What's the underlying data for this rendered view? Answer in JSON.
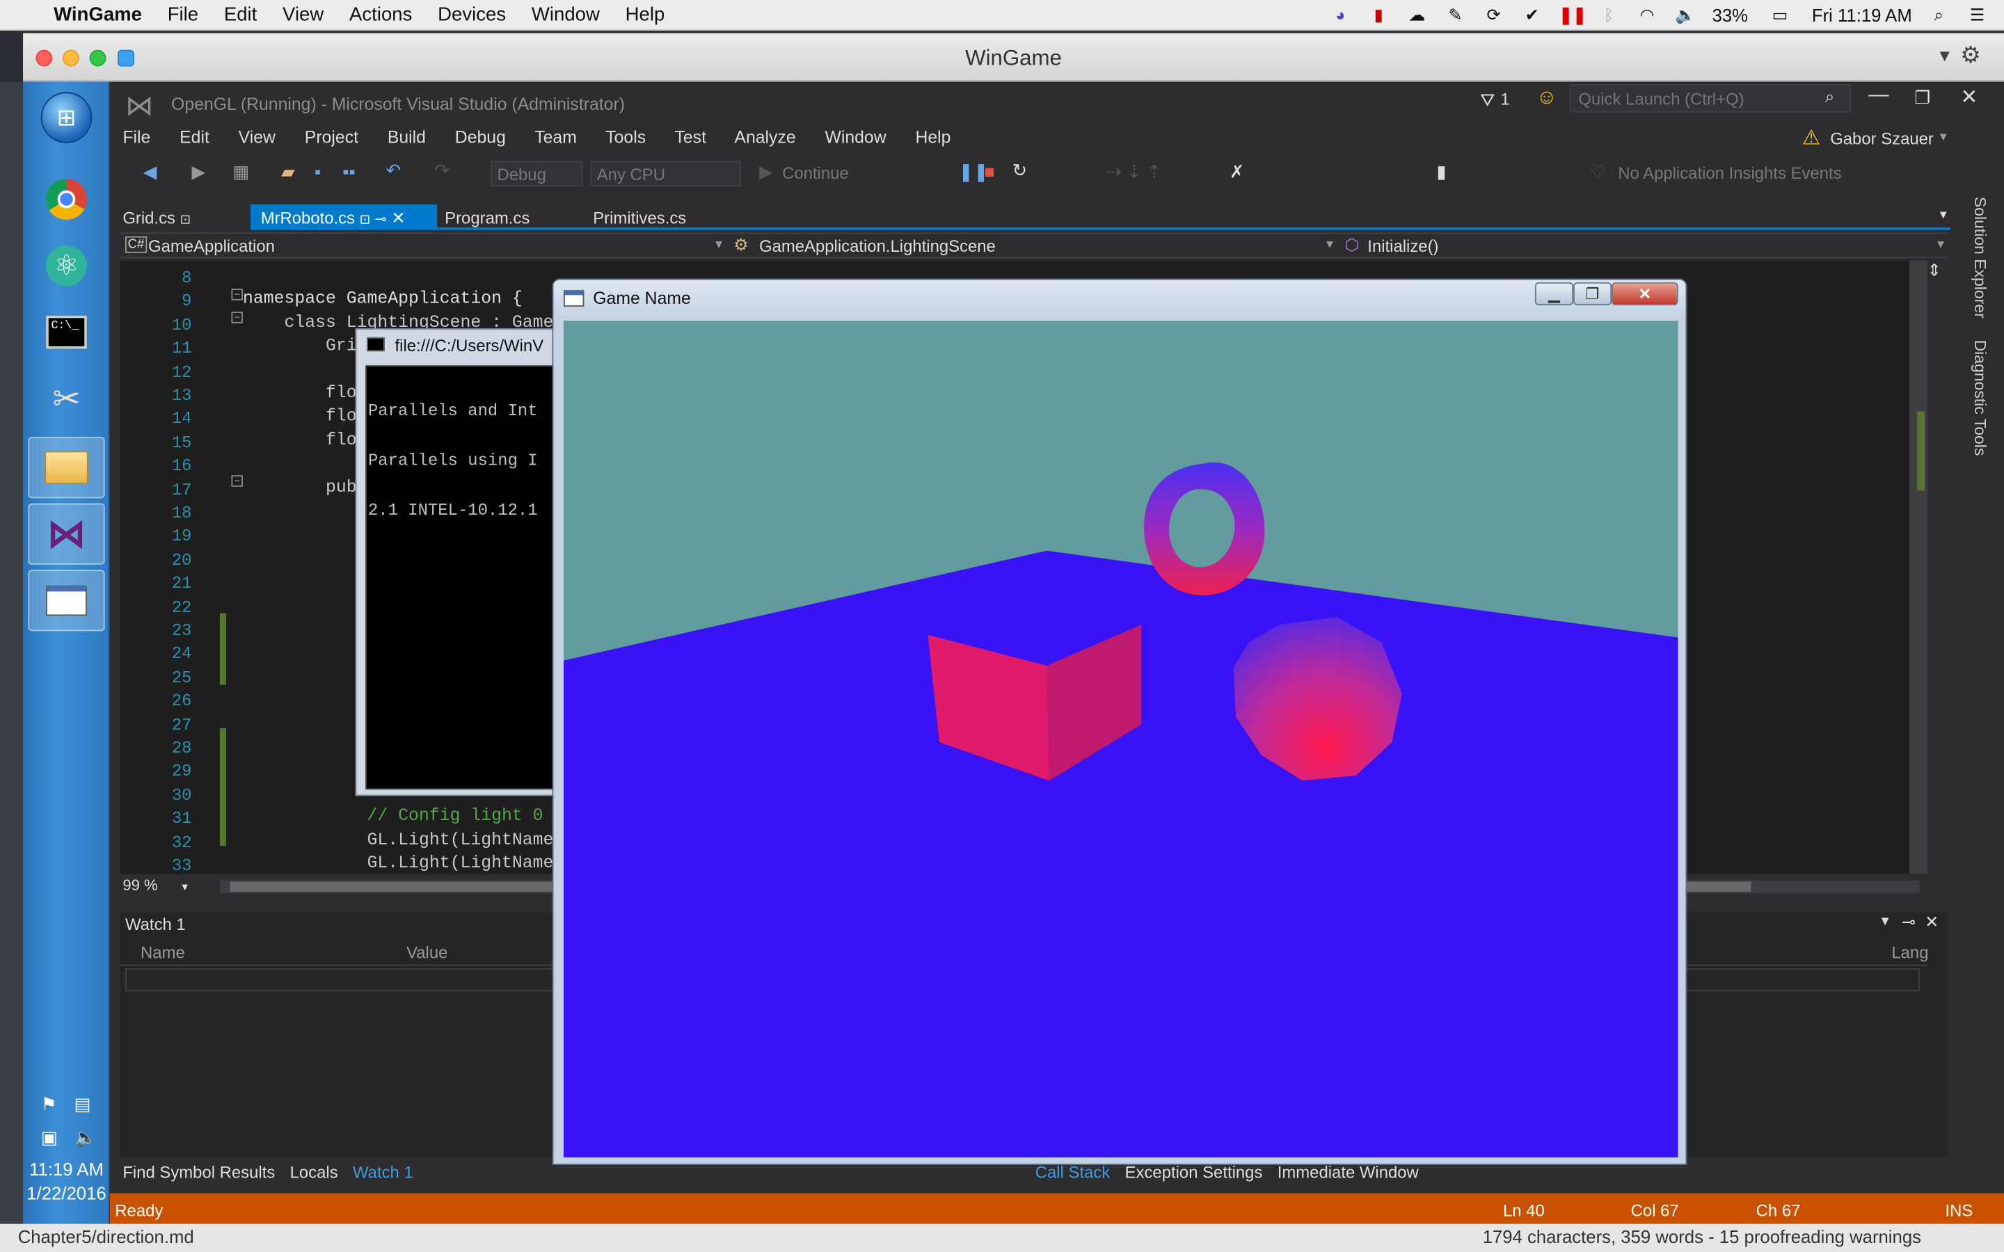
{
  "mac_menubar": {
    "app": "WinGame",
    "items": [
      "File",
      "Edit",
      "View",
      "Actions",
      "Devices",
      "Window",
      "Help"
    ],
    "battery": "33%",
    "clock": "Fri 11:19 AM"
  },
  "window": {
    "title": "WinGame"
  },
  "taskbar": {
    "time": "11:19 AM",
    "date": "1/22/2016"
  },
  "vs": {
    "title": "OpenGL (Running) - Microsoft Visual Studio (Administrator)",
    "notifications": "1",
    "quick_launch_placeholder": "Quick Launch (Ctrl+Q)",
    "user": "Gabor Szauer",
    "menu": [
      "File",
      "Edit",
      "View",
      "Project",
      "Build",
      "Debug",
      "Team",
      "Tools",
      "Test",
      "Analyze",
      "Window",
      "Help"
    ],
    "toolbar": {
      "config": "Debug",
      "platform": "Any CPU",
      "continue": "Continue",
      "insights": "No Application Insights Events"
    },
    "tabs": [
      {
        "label": "Grid.cs"
      },
      {
        "label": "MrRoboto.cs"
      },
      {
        "label": "Program.cs"
      },
      {
        "label": "Primitives.cs"
      }
    ],
    "nav": {
      "project": "GameApplication",
      "type": "GameApplication.LightingScene",
      "member": "Initialize()"
    },
    "side_panels": [
      "Solution Explorer",
      "Diagnostic Tools"
    ],
    "code_lines": [
      {
        "n": "8",
        "text": ""
      },
      {
        "n": "9",
        "text": "namespace GameApplication {"
      },
      {
        "n": "10",
        "text": "    class LightingScene : Game{"
      },
      {
        "n": "11",
        "text": "        Gri"
      },
      {
        "n": "12",
        "text": ""
      },
      {
        "n": "13",
        "text": "        flo"
      },
      {
        "n": "14",
        "text": "        flo"
      },
      {
        "n": "15",
        "text": "        flo"
      },
      {
        "n": "16",
        "text": ""
      },
      {
        "n": "17",
        "text": "        pub"
      },
      {
        "n": "18",
        "text": ""
      },
      {
        "n": "19",
        "text": ""
      },
      {
        "n": "20",
        "text": ""
      },
      {
        "n": "21",
        "text": ""
      },
      {
        "n": "22",
        "text": ""
      },
      {
        "n": "23",
        "text": ""
      },
      {
        "n": "24",
        "text": ""
      },
      {
        "n": "25",
        "text": ""
      },
      {
        "n": "26",
        "text": ""
      },
      {
        "n": "27",
        "text": ""
      },
      {
        "n": "28",
        "text": ""
      },
      {
        "n": "29",
        "text": ""
      },
      {
        "n": "30",
        "text": ""
      },
      {
        "n": "31",
        "text": "            // Config light 0"
      },
      {
        "n": "32",
        "text": "            GL.Light(LightName."
      },
      {
        "n": "33",
        "text": "            GL.Light(LightName."
      }
    ],
    "zoom": "99 %",
    "watch": {
      "title": "Watch 1",
      "col_name": "Name",
      "col_value": "Value",
      "col_lang": "Lang"
    },
    "bottom_tabs_left": [
      "Find Symbol Results",
      "Locals",
      "Watch 1"
    ],
    "bottom_tabs_right": [
      "Call Stack",
      "Exception Settings",
      "Immediate Window"
    ],
    "status": {
      "ready": "Ready",
      "ln": "Ln 40",
      "col": "Col 67",
      "ch": "Ch 67",
      "ins": "INS"
    }
  },
  "console": {
    "title": "file:///C:/Users/WinV",
    "lines": [
      "Parallels and Int",
      "Parallels using I",
      "2.1 INTEL-10.12.1"
    ]
  },
  "game": {
    "title": "Game Name"
  },
  "desktop_bottom": {
    "left": "Chapter5/direction.md",
    "right": "1794 characters, 359 words - 15 proofreading warnings"
  }
}
